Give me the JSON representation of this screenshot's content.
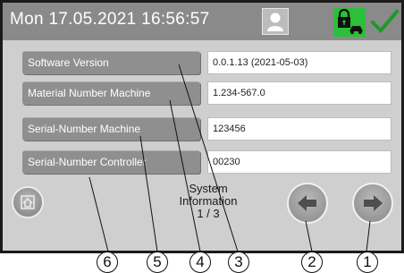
{
  "header": {
    "datetime": "Mon 17.05.2021  16:56:57",
    "user_icon": "user-icon",
    "lock_icon": "lock-icon",
    "confirm_icon": "checkmark-icon"
  },
  "rows": [
    {
      "label": "Software Version",
      "value": "0.0.1.13  (2021-05-03)"
    },
    {
      "label": "Material Number Machine",
      "value": "1.234-567.0"
    },
    {
      "label": "Serial-Number Machine",
      "value": "123456"
    },
    {
      "label": "Serial-Number Controller",
      "value": "00230"
    }
  ],
  "page_info": {
    "line1": "System",
    "line2": "Information",
    "line3": "1 / 3"
  },
  "callouts": [
    "6",
    "5",
    "4",
    "3",
    "2",
    "1"
  ],
  "colors": {
    "header_bg": "#8a8a8a",
    "panel_bg": "#cfcfcf",
    "accent_green": "#2bbf3a"
  }
}
